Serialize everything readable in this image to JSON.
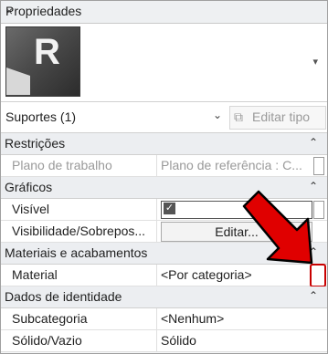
{
  "panel": {
    "title": "Propriedades",
    "close_symbol": "×"
  },
  "type_selector": {
    "logo_letter": "R",
    "dropdown_symbol": "▾"
  },
  "filter": {
    "label": "Suportes (1)",
    "dropdown_symbol": "⌄",
    "edit_type_label": "Editar tipo",
    "edit_type_icon": "⧉"
  },
  "sections": {
    "restricoes": {
      "title": "Restrições",
      "collapse": "⌃"
    },
    "graficos": {
      "title": "Gráficos",
      "collapse": "⌃"
    },
    "materiais": {
      "title": "Materiais e acabamentos",
      "collapse": "⌃"
    },
    "dados": {
      "title": "Dados de identidade",
      "collapse": "⌃"
    }
  },
  "rows": {
    "plano": {
      "key": "Plano de trabalho",
      "value": "Plano de referência : C..."
    },
    "visivel": {
      "key": "Visível",
      "checked_symbol": "✓"
    },
    "visibilidade": {
      "key": "Visibilidade/Sobrepos...",
      "button": "Editar..."
    },
    "material": {
      "key": "Material",
      "value": "<Por categoria>"
    },
    "subcategoria": {
      "key": "Subcategoria",
      "value": "<Nenhum>"
    },
    "solido": {
      "key": "Sólido/Vazio",
      "value": "Sólido"
    }
  },
  "colors": {
    "annotation_arrow": "#e00000",
    "arrow_outline": "#000000",
    "highlight_box": "#c80000"
  }
}
